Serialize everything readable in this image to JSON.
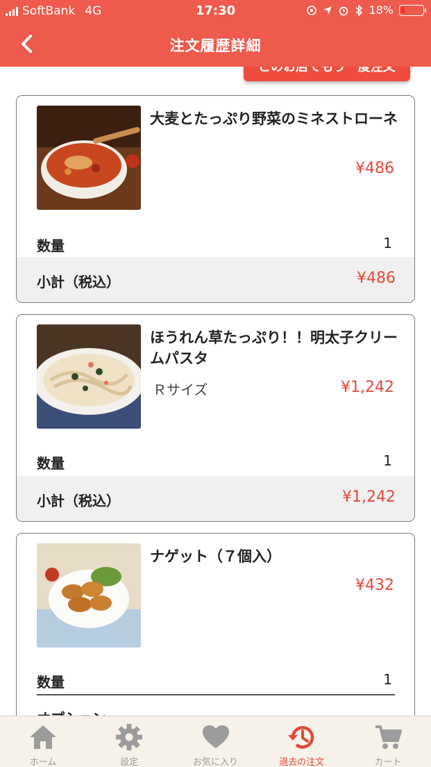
{
  "status_bar": {
    "carrier": "SoftBank",
    "network": "4G",
    "time": "17:30",
    "battery": "18%"
  },
  "nav": {
    "title": "注文履歴詳細",
    "reorder_label": "このお店でもう一度注文"
  },
  "items": [
    {
      "name": "大麦とたっぷり野菜のミネストローネ",
      "variant": "",
      "price": "¥486",
      "quantity_label": "数量",
      "quantity": "1",
      "subtotal_label": "小計（税込）",
      "subtotal": "¥486"
    },
    {
      "name": "ほうれん草たっぷり！！明太子クリームパスタ",
      "variant": "Ｒサイズ",
      "price": "¥1,242",
      "quantity_label": "数量",
      "quantity": "1",
      "subtotal_label": "小計（税込）",
      "subtotal": "¥1,242"
    },
    {
      "name": "ナゲット（７個入）",
      "variant": "",
      "price": "¥432",
      "quantity_label": "数量",
      "quantity": "1",
      "option_label": "オプション"
    }
  ],
  "tabbar": {
    "items": [
      {
        "label": "ホーム",
        "icon": "home-icon"
      },
      {
        "label": "設定",
        "icon": "gear-icon"
      },
      {
        "label": "お気に入り",
        "icon": "heart-icon"
      },
      {
        "label": "過去の注文",
        "icon": "history-icon",
        "active": true
      },
      {
        "label": "カート",
        "icon": "cart-icon"
      }
    ]
  },
  "colors": {
    "brand": "#ee5a4c",
    "price": "#e2493a",
    "tab_inactive": "#9c9c9c",
    "tab_background": "#f6f2ea"
  }
}
